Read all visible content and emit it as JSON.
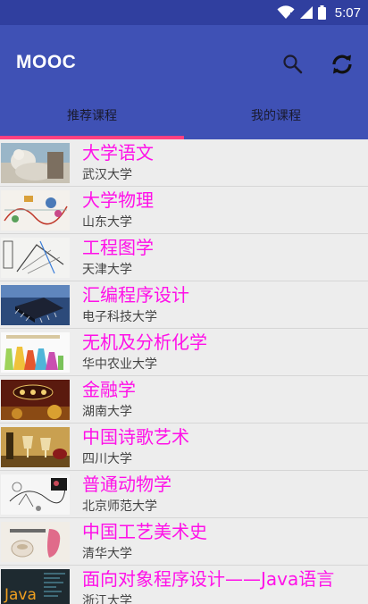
{
  "status_bar": {
    "time": "5:07"
  },
  "app_bar": {
    "title": "MOOC"
  },
  "tabs": [
    {
      "label": "推荐课程",
      "selected": true
    },
    {
      "label": "我的课程",
      "selected": false
    }
  ],
  "courses": [
    {
      "title": "大学语文",
      "school": "武汉大学",
      "thumb": "statue-photo"
    },
    {
      "title": "大学物理",
      "school": "山东大学",
      "thumb": "physics-diagram"
    },
    {
      "title": "工程图学",
      "school": "天津大学",
      "thumb": "engineering-drawing"
    },
    {
      "title": "汇编程序设计",
      "school": "电子科技大学",
      "thumb": "chip-photo"
    },
    {
      "title": "无机及分析化学",
      "school": "华中农业大学",
      "thumb": "chemistry-flasks"
    },
    {
      "title": "金融学",
      "school": "湖南大学",
      "thumb": "finance-banner"
    },
    {
      "title": "中国诗歌艺术",
      "school": "四川大学",
      "thumb": "wine-glasses"
    },
    {
      "title": "普通动物学",
      "school": "北京师范大学",
      "thumb": "zoology-diagram"
    },
    {
      "title": "中国工艺美术史",
      "school": "清华大学",
      "thumb": "craft-ceramics"
    },
    {
      "title": "面向对象程序设计——Java语言",
      "school": "浙江大学",
      "thumb": "java-logo"
    }
  ],
  "colors": {
    "status_bar": "#303f9f",
    "app_bar": "#3f51b5",
    "tab_indicator": "#ff4081",
    "course_title": "#ff10e8"
  }
}
